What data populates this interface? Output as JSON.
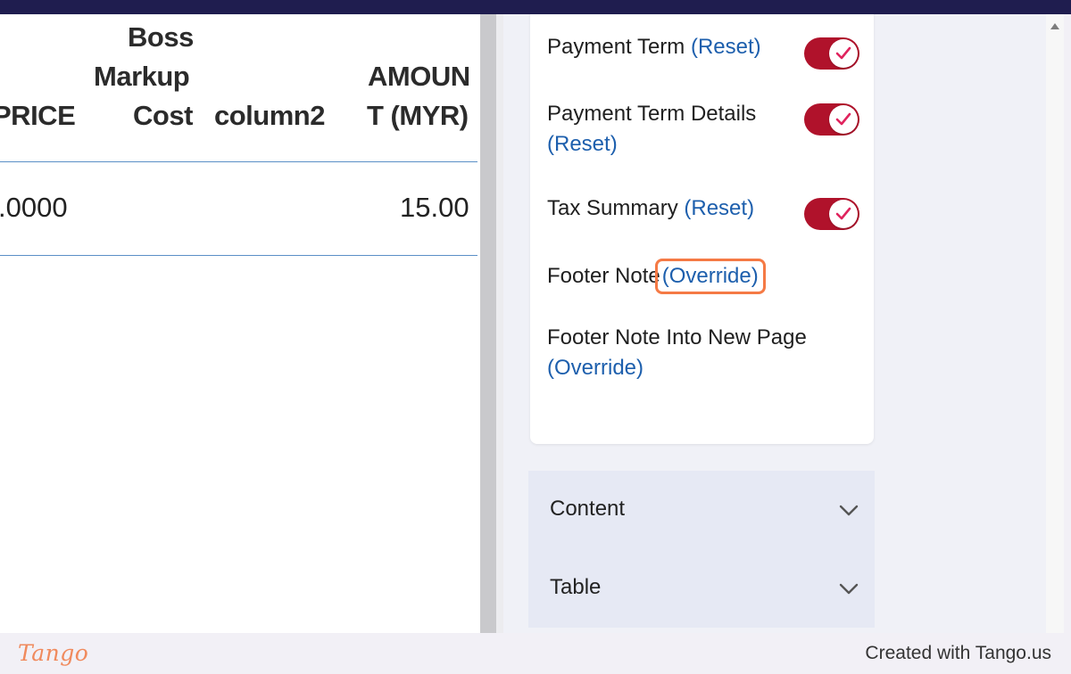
{
  "table": {
    "headers": {
      "price": "PRICE",
      "boss_markup_line1": "Boss",
      "boss_markup_line2": "Markup",
      "boss_markup_line3": "Cost",
      "column2": "column2",
      "amount_line1": "AMOUN",
      "amount_line2": "T (MYR)"
    },
    "row": {
      "price": ".0000",
      "boss_markup_cost": "",
      "column2": "",
      "amount": "15.00"
    }
  },
  "settings": {
    "payment_term": {
      "label": "Payment Term",
      "link": "(Reset)",
      "enabled": true
    },
    "payment_term_details": {
      "label": "Payment Term Details",
      "link": "(Reset)",
      "enabled": true
    },
    "tax_summary": {
      "label": "Tax Summary",
      "link": "(Reset)",
      "enabled": true
    },
    "footer_note": {
      "label": "Footer Note",
      "link": "(Override)"
    },
    "footer_note_new_page": {
      "label": "Footer Note Into New Page",
      "link": "(Override)"
    }
  },
  "accordions": [
    {
      "label": "Content"
    },
    {
      "label": "Table"
    }
  ],
  "footer": {
    "brand": "Tango",
    "credit": "Created with Tango.us"
  },
  "colors": {
    "toggle_on": "#b0122b",
    "link": "#1d5fad",
    "highlight": "#f57a45",
    "topbar": "#1f1d4f"
  }
}
